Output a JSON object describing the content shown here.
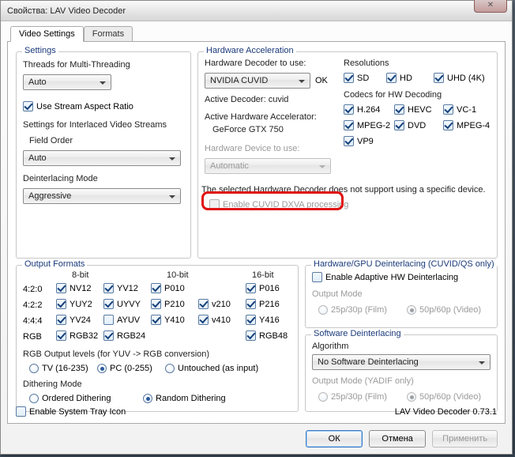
{
  "title": "Свойства: LAV Video Decoder",
  "tabs": {
    "settings": "Video Settings",
    "formats": "Formats"
  },
  "settings_group": {
    "label": "Settings",
    "threads_label": "Threads for Multi-Threading",
    "threads_value": "Auto",
    "use_stream_ar": "Use Stream Aspect Ratio",
    "interlaced_header": "Settings for Interlaced Video Streams",
    "field_order_label": "Field Order",
    "field_order_value": "Auto",
    "deint_mode_label": "Deinterlacing Mode",
    "deint_mode_value": "Aggressive"
  },
  "hwaccel": {
    "label": "Hardware Acceleration",
    "decoder_use_label": "Hardware Decoder to use:",
    "decoder_use_value": "NVIDIA CUVID",
    "decoder_use_ok": "OK",
    "active_decoder": "Active Decoder:   cuvid",
    "active_hw_label": "Active Hardware Accelerator:",
    "active_hw_value": "GeForce GTX 750",
    "hw_device_label": "Hardware Device to use:",
    "hw_device_value": "Automatic",
    "no_support": "The selected Hardware Decoder does not support using a specific device.",
    "cuvid_dxva": "Enable CUVID DXVA processing",
    "res_label": "Resolutions",
    "res": {
      "sd": "SD",
      "hd": "HD",
      "uhd": "UHD (4K)"
    },
    "codecs_label": "Codecs for HW Decoding",
    "codecs": {
      "h264": "H.264",
      "hevc": "HEVC",
      "vc1": "VC-1",
      "mpeg2": "MPEG-2",
      "dvd": "DVD",
      "mpeg4": "MPEG-4",
      "vp9": "VP9"
    }
  },
  "output": {
    "label": "Output Formats",
    "bits": {
      "b8": "8-bit",
      "b10": "10-bit",
      "b16": "16-bit"
    },
    "rows": {
      "r420": "4:2:0",
      "r422": "4:2:2",
      "r444": "4:4:4",
      "rrgb": "RGB"
    },
    "fmts": {
      "nv12": "NV12",
      "yv12": "YV12",
      "p010": "P010",
      "p016": "P016",
      "yuy2": "YUY2",
      "uyvy": "UYVY",
      "p210": "P210",
      "v210": "v210",
      "p216": "P216",
      "yv24": "YV24",
      "ayuv": "AYUV",
      "y410": "Y410",
      "v410": "v410",
      "y416": "Y416",
      "rgb32": "RGB32",
      "rgb24": "RGB24",
      "rgb48": "RGB48"
    },
    "rgb_levels_label": "RGB Output levels (for YUV -> RGB conversion)",
    "rgb_levels": {
      "tv": "TV (16-235)",
      "pc": "PC (0-255)",
      "untouched": "Untouched (as input)"
    },
    "dither_label": "Dithering Mode",
    "dither": {
      "ordered": "Ordered Dithering",
      "random": "Random Dithering"
    }
  },
  "hwdeint": {
    "label": "Hardware/GPU Deinterlacing (CUVID/QS only)",
    "adaptive": "Enable Adaptive HW Deinterlacing",
    "outmode_label": "Output Mode",
    "m25": "25p/30p (Film)",
    "m50": "50p/60p (Video)"
  },
  "swdeint": {
    "label": "Software Deinterlacing",
    "algo_label": "Algorithm",
    "algo_value": "No Software Deinterlacing",
    "outmode_label": "Output Mode (YADIF only)",
    "m25": "25p/30p (Film)",
    "m50": "50p/60p (Video)"
  },
  "tray": "Enable System Tray Icon",
  "footer": "LAV Video Decoder 0.73.1",
  "buttons": {
    "ok": "ОК",
    "cancel": "Отмена",
    "apply": "Применить"
  }
}
